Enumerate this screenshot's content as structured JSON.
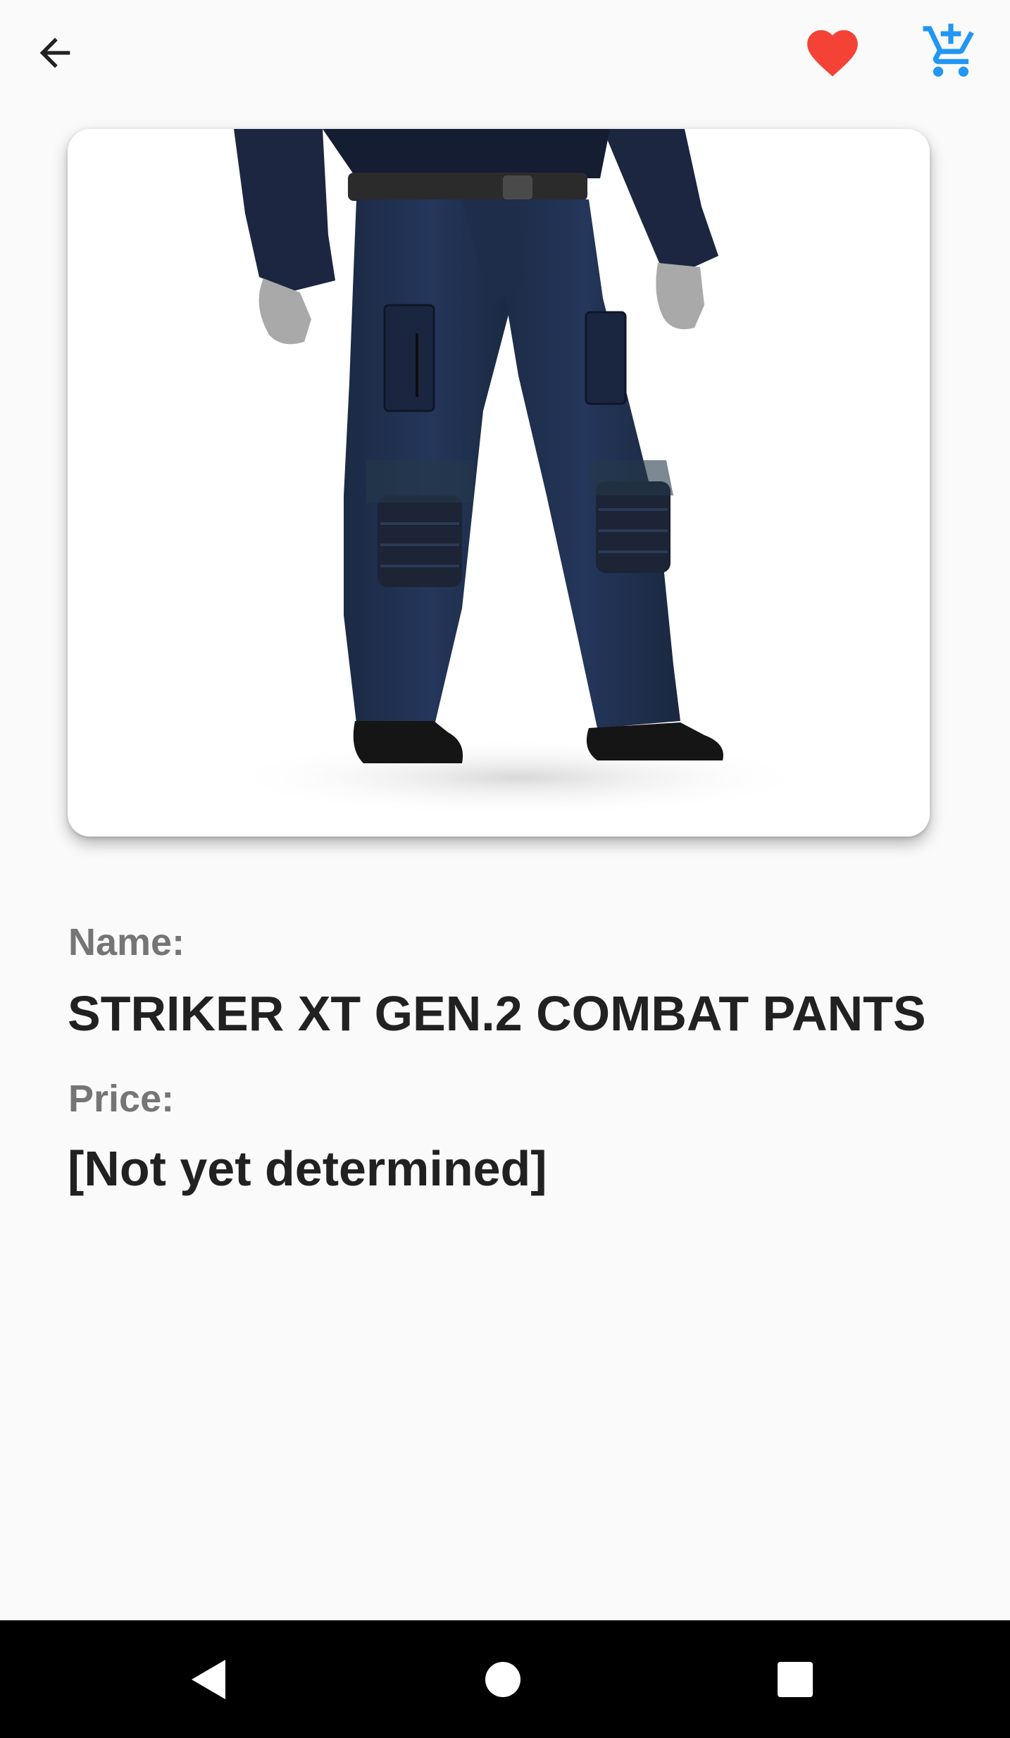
{
  "toolbar": {
    "back_icon": "arrow-back-icon",
    "favorite_icon": "heart-icon",
    "favorite_color": "#f44336",
    "cart_icon": "add-shopping-cart-icon",
    "cart_color": "#2196f3"
  },
  "product": {
    "image_subject": "product-photo",
    "name_label": "Name:",
    "name": "STRIKER XT GEN.2 COMBAT PANTS",
    "price_label": "Price:",
    "price": "[Not yet determined]"
  },
  "nav_bar": {
    "back_icon": "triangle-back-icon",
    "home_icon": "circle-home-icon",
    "recents_icon": "square-recents-icon"
  },
  "colors": {
    "background": "#fafafa",
    "label_text": "#757575",
    "value_text": "#212121",
    "nav_background": "#000000"
  }
}
